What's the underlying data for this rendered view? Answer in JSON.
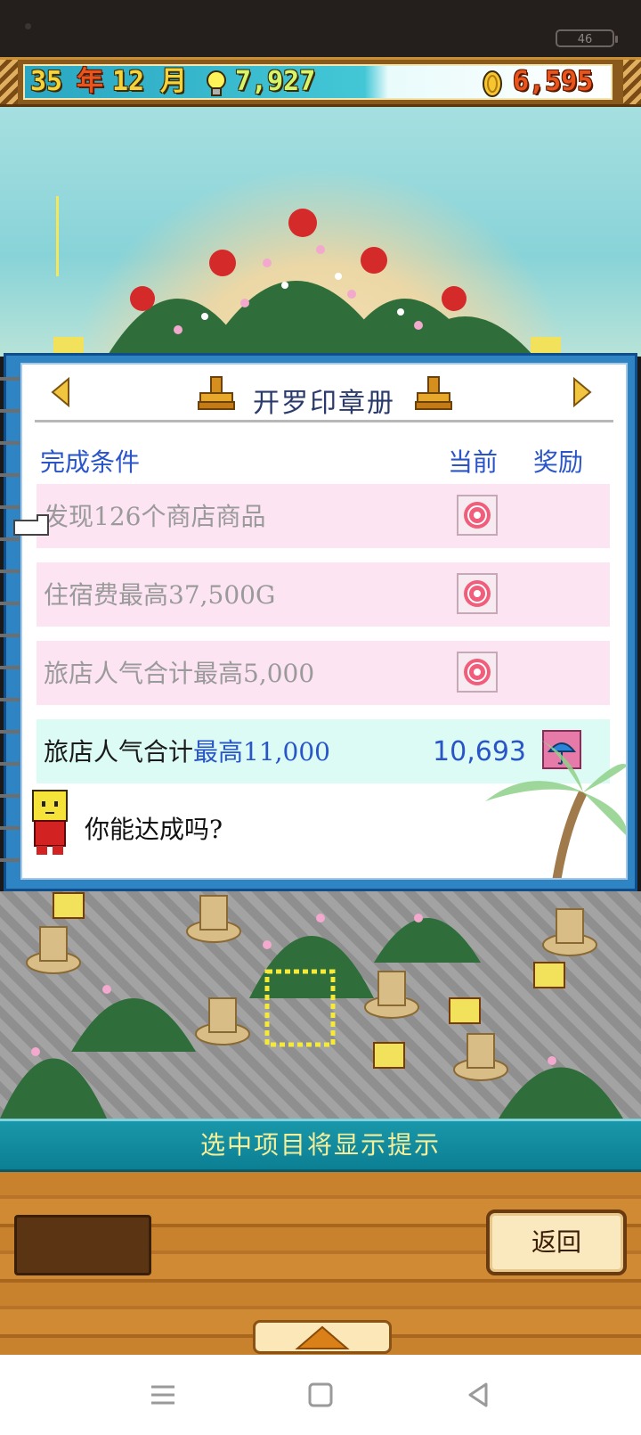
{
  "status_bar": {
    "battery": "46"
  },
  "top_bar": {
    "year_value": "35",
    "year_unit": "年",
    "month_value": "12",
    "month_unit": "月",
    "research_points": "7,927",
    "money": "6,595",
    "icons": [
      "bulb-icon",
      "coin-icon"
    ]
  },
  "panel": {
    "title": "开罗印章册",
    "headers": {
      "condition": "完成条件",
      "current": "当前",
      "reward": "奖励"
    },
    "rows": [
      {
        "label": "发现126个商店商品",
        "status": "completed"
      },
      {
        "label": "住宿费最高37,500G",
        "status": "completed"
      },
      {
        "label": "旅店人气合计最高5,000",
        "status": "completed"
      }
    ],
    "active_row": {
      "label_prefix": "旅店人气合计",
      "label_highlight": "最高11,000",
      "current": "10,693",
      "reward_icon": "umbrella-icon"
    },
    "hint": "你能达成吗?"
  },
  "hint_bar": {
    "text": "选中项目将显示提示"
  },
  "bottom": {
    "back_label": "返回"
  },
  "colors": {
    "accent_blue": "#2a55c8",
    "frame_blue": "#2f84c4",
    "row_pink": "#fde4f3",
    "row_teal": "#dcfbf4",
    "hint_yellow": "#f5ef9a"
  }
}
